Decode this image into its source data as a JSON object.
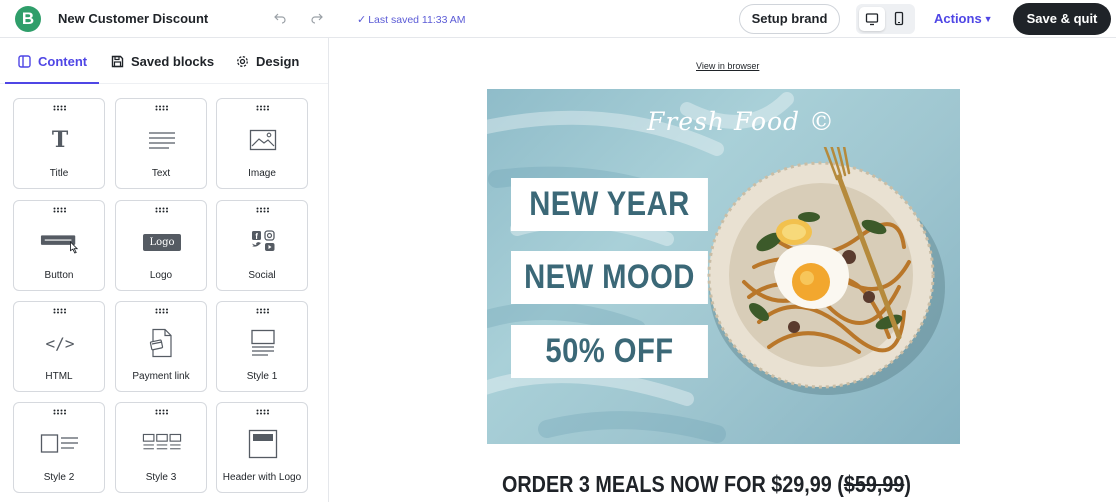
{
  "app": {
    "logo_letter": "B",
    "document_title": "New Customer Discount",
    "saved_status": "Last saved 11:33 AM",
    "setup_brand_label": "Setup brand",
    "actions_label": "Actions",
    "save_quit_label": "Save & quit",
    "accent_color": "#4f46e5",
    "brand_color": "#2f9e6a"
  },
  "sidebar": {
    "tabs": [
      {
        "label": "Content",
        "icon": "content-panel-icon",
        "active": true
      },
      {
        "label": "Saved blocks",
        "icon": "save-icon",
        "active": false
      },
      {
        "label": "Design",
        "icon": "gear-icon",
        "active": false
      }
    ],
    "blocks": [
      {
        "label": "Title",
        "icon": "title-icon",
        "glyph": "T"
      },
      {
        "label": "Text",
        "icon": "text-icon"
      },
      {
        "label": "Image",
        "icon": "image-icon"
      },
      {
        "label": "Button",
        "icon": "button-icon"
      },
      {
        "label": "Logo",
        "icon": "logo-icon",
        "glyph": "Logo"
      },
      {
        "label": "Social",
        "icon": "social-icon"
      },
      {
        "label": "HTML",
        "icon": "code-icon",
        "glyph": "</>"
      },
      {
        "label": "Payment link",
        "icon": "payment-icon"
      },
      {
        "label": "Style 1",
        "icon": "style1-icon"
      },
      {
        "label": "Style 2",
        "icon": "style2-icon"
      },
      {
        "label": "Style 3",
        "icon": "style3-icon"
      },
      {
        "label": "Header with Logo",
        "icon": "header-logo-icon"
      }
    ]
  },
  "canvas": {
    "view_in_browser": "View in browser",
    "hero": {
      "brand": "Fresh Food ©",
      "lines": [
        "NEW YEAR",
        "NEW MOOD",
        "50% OFF"
      ],
      "background_color": "#9cc7d1",
      "text_color": "#3b6877"
    },
    "offer_main": "ORDER 3 MEALS NOW FOR $29,99 (",
    "offer_strike": "$59,99",
    "offer_close": ")"
  }
}
